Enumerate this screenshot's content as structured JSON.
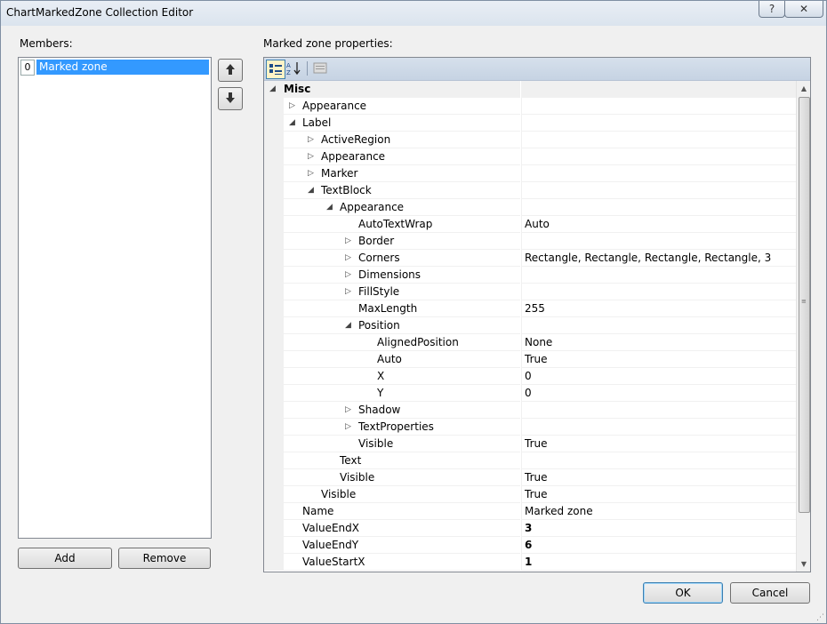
{
  "window": {
    "title": "ChartMarkedZone Collection Editor",
    "help_label": "?",
    "close_label": "✕"
  },
  "members": {
    "label": "Members:",
    "items": [
      {
        "index": "0",
        "name": "Marked zone"
      }
    ],
    "move_up_icon": "arrow-up-icon",
    "move_down_icon": "arrow-down-icon",
    "add_label": "Add",
    "remove_label": "Remove"
  },
  "properties": {
    "label": "Marked zone properties:",
    "toolbar": {
      "categorized_icon": "categorized-icon",
      "alphabetical_icon": "alphabetical-icon",
      "property_pages_icon": "property-pages-icon"
    },
    "rows": [
      {
        "name": "Misc",
        "value": "",
        "exp": "open",
        "bold": true,
        "cat": true
      },
      {
        "name": "Appearance",
        "value": "",
        "exp": "closed"
      },
      {
        "name": "Label",
        "value": "",
        "exp": "open"
      },
      {
        "name": "ActiveRegion",
        "value": "",
        "exp": "closed"
      },
      {
        "name": "Appearance",
        "value": "",
        "exp": "closed"
      },
      {
        "name": "Marker",
        "value": "",
        "exp": "closed"
      },
      {
        "name": "TextBlock",
        "value": "",
        "exp": "open"
      },
      {
        "name": "Appearance",
        "value": "",
        "exp": "open"
      },
      {
        "name": "AutoTextWrap",
        "value": "Auto",
        "exp": ""
      },
      {
        "name": "Border",
        "value": "",
        "exp": "closed"
      },
      {
        "name": "Corners",
        "value": "Rectangle, Rectangle, Rectangle, Rectangle, 3",
        "exp": "closed"
      },
      {
        "name": "Dimensions",
        "value": "",
        "exp": "closed"
      },
      {
        "name": "FillStyle",
        "value": "",
        "exp": "closed"
      },
      {
        "name": "MaxLength",
        "value": "255",
        "exp": ""
      },
      {
        "name": "Position",
        "value": "",
        "exp": "open"
      },
      {
        "name": "AlignedPosition",
        "value": "None",
        "exp": ""
      },
      {
        "name": "Auto",
        "value": "True",
        "exp": ""
      },
      {
        "name": "X",
        "value": "0",
        "exp": ""
      },
      {
        "name": "Y",
        "value": "0",
        "exp": ""
      },
      {
        "name": "Shadow",
        "value": "",
        "exp": "closed"
      },
      {
        "name": "TextProperties",
        "value": "",
        "exp": "closed"
      },
      {
        "name": "Visible",
        "value": "True",
        "exp": ""
      },
      {
        "name": "Text",
        "value": "",
        "exp": ""
      },
      {
        "name": "Visible",
        "value": "True",
        "exp": ""
      },
      {
        "name": "Visible",
        "value": "True",
        "exp": ""
      },
      {
        "name": "Name",
        "value": "Marked zone",
        "exp": ""
      },
      {
        "name": "ValueEndX",
        "value": "3",
        "exp": "",
        "boldval": true
      },
      {
        "name": "ValueEndY",
        "value": "6",
        "exp": "",
        "boldval": true
      },
      {
        "name": "ValueStartX",
        "value": "1",
        "exp": "",
        "boldval": true
      }
    ]
  },
  "buttons": {
    "ok_label": "OK",
    "cancel_label": "Cancel"
  },
  "colors": {
    "selection": "#3399ff",
    "category_bg": "#f0f0f0"
  }
}
